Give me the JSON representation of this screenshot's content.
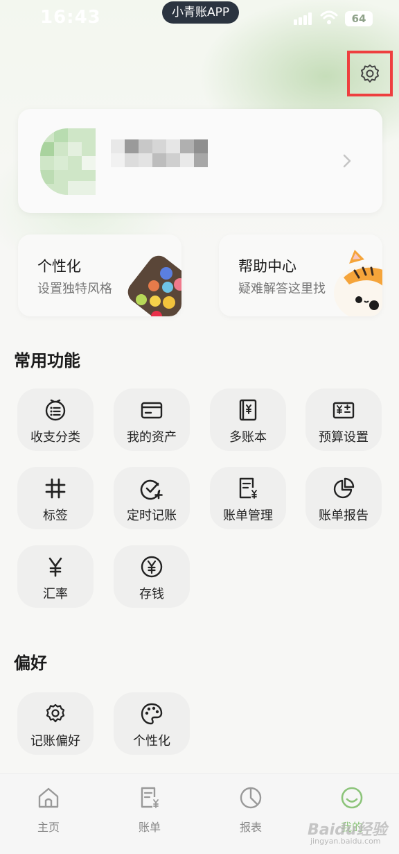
{
  "status_bar": {
    "time": "16:43",
    "app_name": "小青账APP",
    "battery": "64"
  },
  "profile": {
    "chevron_icon": "chevron-right-icon"
  },
  "features": [
    {
      "title": "个性化",
      "subtitle": "设置独特风格"
    },
    {
      "title": "帮助中心",
      "subtitle": "疑难解答这里找"
    }
  ],
  "common": {
    "title": "常用功能",
    "items": [
      {
        "label": "收支分类",
        "icon": "category-icon"
      },
      {
        "label": "我的资产",
        "icon": "card-icon"
      },
      {
        "label": "多账本",
        "icon": "ledger-icon"
      },
      {
        "label": "预算设置",
        "icon": "budget-icon"
      },
      {
        "label": "标签",
        "icon": "hash-icon"
      },
      {
        "label": "定时记账",
        "icon": "timer-check-icon"
      },
      {
        "label": "账单管理",
        "icon": "bill-icon"
      },
      {
        "label": "账单报告",
        "icon": "pie-chart-icon"
      },
      {
        "label": "汇率",
        "icon": "yen-icon"
      },
      {
        "label": "存钱",
        "icon": "yen-circle-icon"
      }
    ]
  },
  "preferences": {
    "title": "偏好",
    "items": [
      {
        "label": "记账偏好",
        "icon": "gear-icon"
      },
      {
        "label": "个性化",
        "icon": "palette-icon"
      }
    ]
  },
  "tabbar": [
    {
      "label": "主页",
      "icon": "home-icon"
    },
    {
      "label": "账单",
      "icon": "bill-icon"
    },
    {
      "label": "报表",
      "icon": "chart-icon"
    },
    {
      "label": "我的",
      "icon": "smile-icon",
      "active": true
    }
  ],
  "watermark": {
    "text": "Baidu经验",
    "sub": "jingyan.baidu.com"
  },
  "colors": {
    "accent": "#8cc47a",
    "highlight": "#ee3f3f"
  }
}
